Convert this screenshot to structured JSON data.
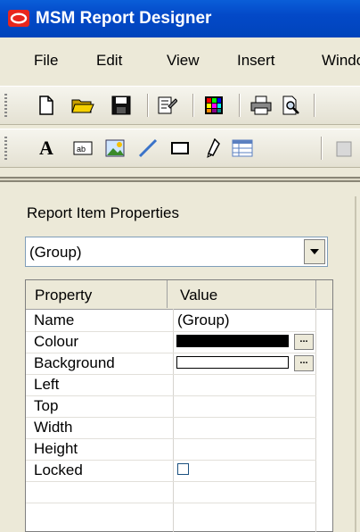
{
  "window": {
    "title": "MSM Report Designer"
  },
  "menu": [
    "File",
    "Edit",
    "View",
    "Insert",
    "Windo"
  ],
  "toolbar1": [
    "new-icon",
    "open-icon",
    "save-icon",
    "properties-icon",
    "color-palette-icon",
    "print-icon",
    "print-preview-icon"
  ],
  "toolbar2": [
    "text-icon",
    "textbox-icon",
    "image-icon",
    "line-icon",
    "rectangle-icon",
    "pen-icon",
    "table-icon",
    "box-icon"
  ],
  "panel": {
    "title": "Report Item Properties",
    "selected_item": "(Group)"
  },
  "grid": {
    "headers": {
      "property": "Property",
      "value": "Value"
    },
    "rows": [
      {
        "name": "Name",
        "value": "(Group)"
      },
      {
        "name": "Colour",
        "value": "",
        "swatch": "#000000",
        "button": "..."
      },
      {
        "name": "Background",
        "value": "",
        "swatch": "#ffffff",
        "button": "..."
      },
      {
        "name": "Left",
        "value": ""
      },
      {
        "name": "Top",
        "value": ""
      },
      {
        "name": "Width",
        "value": ""
      },
      {
        "name": "Height",
        "value": ""
      },
      {
        "name": "Locked",
        "value": "",
        "checkbox": false
      }
    ]
  },
  "colors": {
    "titlebar": "#0349c8",
    "chrome": "#ece9d8"
  }
}
